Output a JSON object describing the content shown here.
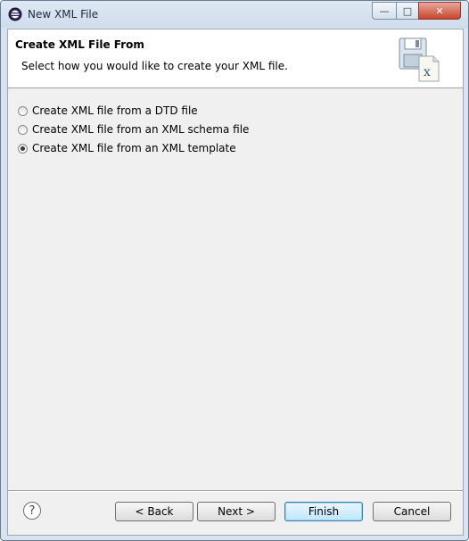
{
  "window": {
    "title": "New XML File",
    "close_glyph": "✕",
    "min_glyph": "—",
    "max_glyph": "□",
    "icon": "eclipse-icon"
  },
  "banner": {
    "title": "Create XML File From",
    "description": "Select how you would like to create your XML file.",
    "icon": "xml-file-icon"
  },
  "options": [
    {
      "label": "Create XML file from a DTD file",
      "selected": false
    },
    {
      "label": "Create XML file from an XML schema file",
      "selected": false
    },
    {
      "label": "Create XML file from an XML template",
      "selected": true
    }
  ],
  "buttons": {
    "back": "< Back",
    "next": "Next >",
    "finish": "Finish",
    "cancel": "Cancel",
    "help": "?"
  }
}
